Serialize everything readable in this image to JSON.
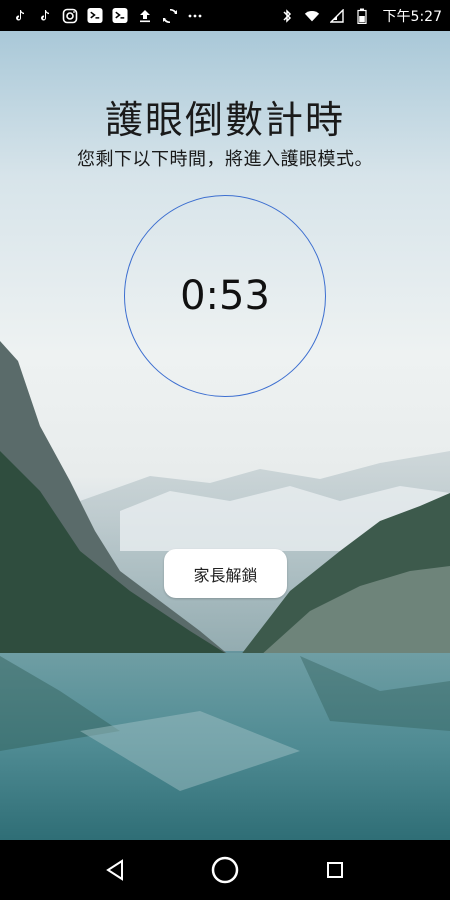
{
  "status_bar": {
    "time": "下午5:27",
    "left_icons": [
      "tiktok-icon",
      "tiktok-icon",
      "instagram-icon",
      "app-icon",
      "app-icon",
      "upload-icon",
      "sync-icon",
      "more-icon"
    ],
    "right_icons": [
      "bluetooth-icon",
      "wifi-icon",
      "signal-icon",
      "battery-icon"
    ]
  },
  "main": {
    "title": "護眼倒數計時",
    "subtitle": "您剩下以下時間，將進入護眼模式。",
    "countdown": "0:53",
    "unlock_label": "家長解鎖"
  },
  "colors": {
    "ring": "#3d6fd0",
    "button_bg": "#ffffff"
  }
}
